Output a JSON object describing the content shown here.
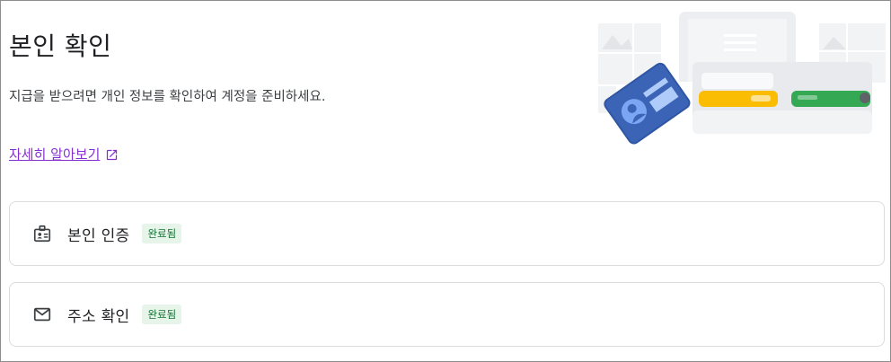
{
  "page": {
    "title": "본인 확인",
    "description": "지급을 받으려면 개인 정보를 확인하여 계정을 준비하세요.",
    "learn_more": "자세히 알아보기"
  },
  "items": [
    {
      "label": "본인 인증",
      "status": "완료됨",
      "icon": "id-badge-icon"
    },
    {
      "label": "주소 확인",
      "status": "완료됨",
      "icon": "mail-icon"
    }
  ],
  "colors": {
    "link": "#8430ce",
    "badge_bg": "#e6f4ea",
    "badge_text": "#137333",
    "card_border": "#dadce0"
  }
}
